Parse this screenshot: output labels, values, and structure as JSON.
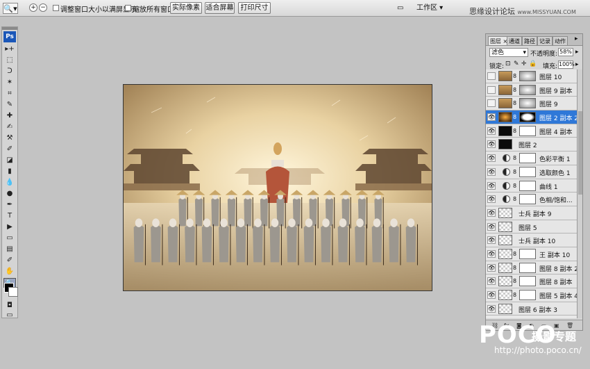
{
  "options_bar": {
    "tool_icon": "zoom-tool-icon",
    "checkbox_resize": "调整窗口大小以满屏显示",
    "checkbox_zoom_all": "缩放所有窗口",
    "buttons": [
      "实际像素",
      "适合屏幕",
      "打印尺寸"
    ],
    "workspace": "工作区 ▾",
    "brand": "思缘设计论坛",
    "brand_url": "www.MISSYUAN.COM"
  },
  "toolbox": {
    "logo": "Ps",
    "tools": [
      "move-tool-icon",
      "marquee-tool-icon",
      "lasso-tool-icon",
      "magic-wand-icon",
      "crop-tool-icon",
      "eyedropper-icon",
      "healing-brush-icon",
      "brush-icon",
      "clone-stamp-icon",
      "history-brush-icon",
      "eraser-icon",
      "gradient-icon",
      "blur-icon",
      "dodge-icon",
      "pen-icon",
      "type-icon",
      "path-select-icon",
      "shape-icon",
      "notes-icon",
      "eyedropper2-icon",
      "hand-icon",
      "zoom-icon"
    ],
    "glyphs": [
      "▸+",
      "⬚",
      "ᑐ",
      "✶",
      "⌗",
      "✎",
      "✚",
      "✍",
      "⚒",
      "✐",
      "◪",
      "▮",
      "💧",
      "●",
      "✒",
      "T",
      "▶",
      "▭",
      "▤",
      "✐",
      "✋",
      "🔍"
    ]
  },
  "panel": {
    "tabs": [
      "图层 ×",
      "通道",
      "路径",
      "记录",
      "动作"
    ],
    "blend_mode": "滤色",
    "opacity_label": "不透明度:",
    "opacity": "58%",
    "lock_label": "锁定:",
    "fill_label": "填充:",
    "fill": "100%",
    "layers": [
      {
        "name": "图层 10",
        "visible": false,
        "type": "photo",
        "mask": true
      },
      {
        "name": "图层 9 副本",
        "visible": false,
        "type": "photo",
        "mask": true
      },
      {
        "name": "图层 9",
        "visible": false,
        "type": "photo",
        "mask": true
      },
      {
        "name": "图层 2 副本 2",
        "visible": true,
        "type": "dark",
        "mask": true,
        "selected": true
      },
      {
        "name": "图层 4 副本",
        "visible": true,
        "type": "black",
        "mask": true
      },
      {
        "name": "图层 2",
        "visible": true,
        "type": "black",
        "mask": false
      },
      {
        "name": "色彩平衡 1",
        "visible": true,
        "type": "adjust",
        "mask": true
      },
      {
        "name": "选取颜色 1",
        "visible": true,
        "type": "adjust",
        "mask": true
      },
      {
        "name": "曲线 1",
        "visible": true,
        "type": "adjust",
        "mask": true
      },
      {
        "name": "色相/饱和...",
        "visible": true,
        "type": "adjust",
        "mask": true
      },
      {
        "name": "士兵 副本 9",
        "visible": true,
        "type": "empty",
        "mask": false
      },
      {
        "name": "图层 5",
        "visible": true,
        "type": "empty",
        "mask": false
      },
      {
        "name": "士兵 副本 10",
        "visible": true,
        "type": "empty",
        "mask": false
      },
      {
        "name": "王 副本 10",
        "visible": true,
        "type": "empty",
        "mask": true
      },
      {
        "name": "图层 8 副本 2",
        "visible": true,
        "type": "empty",
        "mask": true
      },
      {
        "name": "图层 8 副本",
        "visible": true,
        "type": "empty",
        "mask": true
      },
      {
        "name": "图层 5 副本 4",
        "visible": true,
        "type": "empty",
        "mask": true
      },
      {
        "name": "图层 6 副本 3",
        "visible": true,
        "type": "empty",
        "mask": false
      }
    ]
  },
  "watermark": {
    "logo": "POCO",
    "logo_cn": "摄影专题",
    "url": "http://photo.poco.cn/"
  }
}
